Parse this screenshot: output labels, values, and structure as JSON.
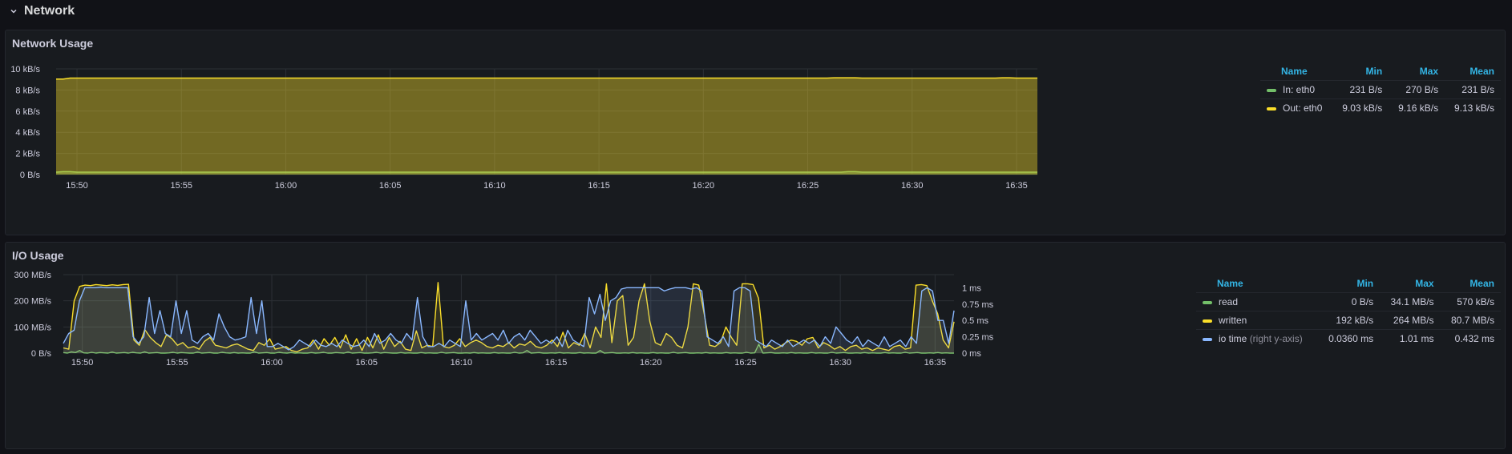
{
  "row": {
    "title": "Network"
  },
  "colors": {
    "green": "#73bf69",
    "yellow": "#fade2a",
    "blue": "#8ab8ff",
    "legend_header": "#33b5e5"
  },
  "network_panel": {
    "title": "Network Usage",
    "legend": {
      "headers": [
        "Name",
        "Min",
        "Max",
        "Mean"
      ],
      "rows": [
        {
          "name": "In: eth0",
          "color": "#73bf69",
          "min": "231 B/s",
          "max": "270 B/s",
          "mean": "231 B/s"
        },
        {
          "name": "Out: eth0",
          "color": "#fade2a",
          "min": "9.03 kB/s",
          "max": "9.16 kB/s",
          "mean": "9.13 kB/s"
        }
      ]
    }
  },
  "io_panel": {
    "title": "I/O Usage",
    "legend": {
      "headers": [
        "Name",
        "Min",
        "Max",
        "Mean"
      ],
      "rows": [
        {
          "name": "read",
          "suffix": "",
          "color": "#73bf69",
          "min": "0 B/s",
          "max": "34.1 MB/s",
          "mean": "570 kB/s"
        },
        {
          "name": "written",
          "suffix": "",
          "color": "#fade2a",
          "min": "192 kB/s",
          "max": "264 MB/s",
          "mean": "80.7 MB/s"
        },
        {
          "name": "io time",
          "suffix": "(right y-axis)",
          "color": "#8ab8ff",
          "min": "0.0360 ms",
          "max": "1.01 ms",
          "mean": "0.432 ms"
        }
      ]
    }
  },
  "chart_data": [
    {
      "type": "area",
      "title": "Network Usage",
      "x_start": "15:49",
      "x_end": "16:36",
      "xticks": [
        "15:50",
        "15:55",
        "16:00",
        "16:05",
        "16:10",
        "16:15",
        "16:20",
        "16:25",
        "16:30",
        "16:35"
      ],
      "yticks": [
        "0 B/s",
        "2 kB/s",
        "4 kB/s",
        "6 kB/s",
        "8 kB/s",
        "10 kB/s"
      ],
      "ylim": [
        0,
        10
      ],
      "y_unit": "kB/s",
      "series": [
        {
          "name": "In: eth0",
          "color": "#73bf69",
          "const": 0.23,
          "bumps": [
            [
              0.5,
              0.27
            ],
            [
              38,
              0.27
            ]
          ]
        },
        {
          "name": "Out: eth0",
          "color": "#fade2a",
          "const": 9.13,
          "bumps": [
            [
              0.1,
              9.03
            ],
            [
              37.5,
              9.16
            ],
            [
              38,
              9.16
            ],
            [
              45.5,
              9.16
            ]
          ]
        }
      ]
    },
    {
      "type": "line",
      "title": "I/O Usage",
      "x_start": "15:49",
      "x_end": "16:36",
      "xticks": [
        "15:50",
        "15:55",
        "16:00",
        "16:05",
        "16:10",
        "16:15",
        "16:20",
        "16:25",
        "16:30",
        "16:35"
      ],
      "yticks": [
        "0 B/s",
        "100 MB/s",
        "200 MB/s",
        "300 MB/s"
      ],
      "ylim": [
        0,
        300
      ],
      "y_unit": "MB/s",
      "y2ticks": [
        "0 ms",
        "0.25 ms",
        "0.5 ms",
        "0.75 ms",
        "1 ms"
      ],
      "y2lim": [
        0,
        1.2
      ],
      "y2_unit": "ms",
      "series": [
        {
          "name": "read",
          "color": "#73bf69",
          "axis": "left",
          "values": [
            2,
            0,
            5,
            2,
            10,
            1,
            0,
            3,
            0,
            2,
            1,
            0,
            4,
            0,
            1,
            2,
            0,
            3,
            1,
            0,
            5,
            0,
            1,
            2,
            0,
            0,
            1,
            3,
            0,
            2,
            1,
            0,
            0,
            4,
            0,
            1,
            2,
            0,
            0,
            3,
            1,
            0,
            2,
            0,
            1,
            0,
            0,
            5,
            0,
            1,
            2,
            0,
            0,
            3,
            1,
            0,
            2,
            0,
            1,
            0,
            0,
            2,
            0,
            1,
            3,
            0,
            0,
            2,
            1,
            0,
            4,
            0,
            1,
            2,
            0,
            0,
            1,
            3,
            0,
            2,
            1,
            0,
            0,
            2,
            0,
            1,
            0,
            0,
            2,
            0,
            1,
            0,
            0,
            3,
            0,
            1,
            2,
            0,
            0,
            1,
            0,
            2,
            0,
            1,
            0,
            0,
            2,
            0,
            1,
            0,
            0,
            3,
            0,
            1,
            10,
            0,
            1,
            2,
            0,
            0,
            1,
            0,
            2,
            0,
            1,
            0,
            0,
            2,
            0,
            1,
            0,
            0,
            10,
            0,
            1,
            2,
            0,
            0,
            1,
            0,
            2,
            0,
            1,
            0,
            0,
            2,
            0,
            1,
            0,
            0,
            3,
            0,
            1,
            2,
            0,
            0,
            1,
            0,
            2,
            0,
            1,
            0,
            0,
            2,
            0,
            1,
            0,
            0,
            3,
            0,
            1,
            34,
            0,
            1,
            2,
            0,
            0,
            1,
            0,
            2,
            0,
            1,
            0,
            0,
            2,
            0,
            1,
            0,
            0,
            3,
            0,
            1,
            2,
            0,
            0,
            1,
            0,
            2,
            0,
            1,
            0,
            0,
            2,
            0,
            1,
            0,
            0,
            3,
            0,
            1,
            2,
            0,
            0,
            1,
            0,
            2,
            0,
            1,
            0,
            0
          ]
        },
        {
          "name": "written",
          "color": "#fade2a",
          "axis": "left",
          "values": [
            20,
            15,
            200,
            255,
            260,
            258,
            262,
            260,
            258,
            261,
            259,
            262,
            263,
            50,
            30,
            90,
            60,
            40,
            25,
            70,
            55,
            30,
            40,
            20,
            25,
            15,
            45,
            60,
            30,
            25,
            20,
            30,
            35,
            25,
            15,
            10,
            40,
            30,
            55,
            15,
            20,
            25,
            10,
            5,
            15,
            20,
            50,
            15,
            55,
            30,
            60,
            20,
            70,
            15,
            55,
            10,
            60,
            20,
            70,
            15,
            60,
            25,
            45,
            15,
            10,
            85,
            20,
            30,
            25,
            270,
            25,
            20,
            30,
            55,
            25,
            40,
            50,
            40,
            25,
            20,
            30,
            25,
            40,
            20,
            35,
            30,
            45,
            25,
            20,
            30,
            50,
            25,
            80,
            20,
            40,
            30,
            75,
            20,
            100,
            60,
            265,
            40,
            200,
            220,
            30,
            60,
            200,
            265,
            120,
            40,
            30,
            75,
            60,
            30,
            20,
            100,
            265,
            260,
            150,
            30,
            25,
            40,
            100,
            60,
            30,
            265,
            265,
            262,
            210,
            20,
            30,
            15,
            25,
            40,
            50,
            45,
            30,
            55,
            60,
            20,
            40,
            30,
            15,
            25,
            10,
            25,
            30,
            15,
            20,
            10,
            20,
            15,
            10,
            25,
            30,
            15,
            20,
            260,
            262,
            258,
            200,
            150,
            50,
            20,
            120
          ]
        },
        {
          "name": "io time",
          "color": "#8ab8ff",
          "axis": "right",
          "values": [
            0.15,
            0.3,
            0.35,
            0.8,
            1.0,
            1.0,
            1.0,
            1.01,
            1.0,
            1.0,
            1.0,
            1.0,
            1.0,
            0.25,
            0.15,
            0.25,
            0.85,
            0.3,
            0.65,
            0.3,
            0.25,
            0.8,
            0.3,
            0.65,
            0.2,
            0.15,
            0.25,
            0.3,
            0.2,
            0.6,
            0.4,
            0.25,
            0.2,
            0.22,
            0.25,
            0.85,
            0.3,
            0.8,
            0.1,
            0.1,
            0.15,
            0.1,
            0.05,
            0.1,
            0.2,
            0.15,
            0.1,
            0.2,
            0.12,
            0.1,
            0.15,
            0.1,
            0.2,
            0.15,
            0.1,
            0.12,
            0.2,
            0.1,
            0.3,
            0.15,
            0.2,
            0.3,
            0.2,
            0.15,
            0.3,
            0.2,
            0.85,
            0.25,
            0.1,
            0.1,
            0.15,
            0.1,
            0.2,
            0.15,
            0.1,
            0.8,
            0.2,
            0.3,
            0.2,
            0.25,
            0.3,
            0.2,
            0.35,
            0.15,
            0.25,
            0.3,
            0.2,
            0.35,
            0.25,
            0.15,
            0.2,
            0.15,
            0.25,
            0.1,
            0.35,
            0.2,
            0.15,
            0.1,
            0.85,
            0.6,
            0.9,
            0.5,
            0.8,
            0.85,
            0.98,
            1.0,
            1.0,
            1.0,
            1.0,
            1.0,
            1.0,
            1.0,
            0.95,
            0.98,
            1.0,
            1.0,
            1.0,
            0.98,
            1.0,
            0.95,
            0.25,
            0.2,
            0.15,
            0.25,
            0.1,
            0.95,
            1.0,
            1.0,
            0.95,
            0.2,
            0.15,
            0.1,
            0.2,
            0.15,
            0.1,
            0.2,
            0.1,
            0.15,
            0.2,
            0.15,
            0.2,
            0.1,
            0.25,
            0.15,
            0.4,
            0.3,
            0.2,
            0.15,
            0.25,
            0.1,
            0.2,
            0.15,
            0.1,
            0.25,
            0.1,
            0.15,
            0.2,
            0.1,
            0.25,
            0.15,
            0.95,
            1.0,
            0.95,
            0.5,
            0.5,
            0.15,
            0.65
          ]
        }
      ]
    }
  ]
}
